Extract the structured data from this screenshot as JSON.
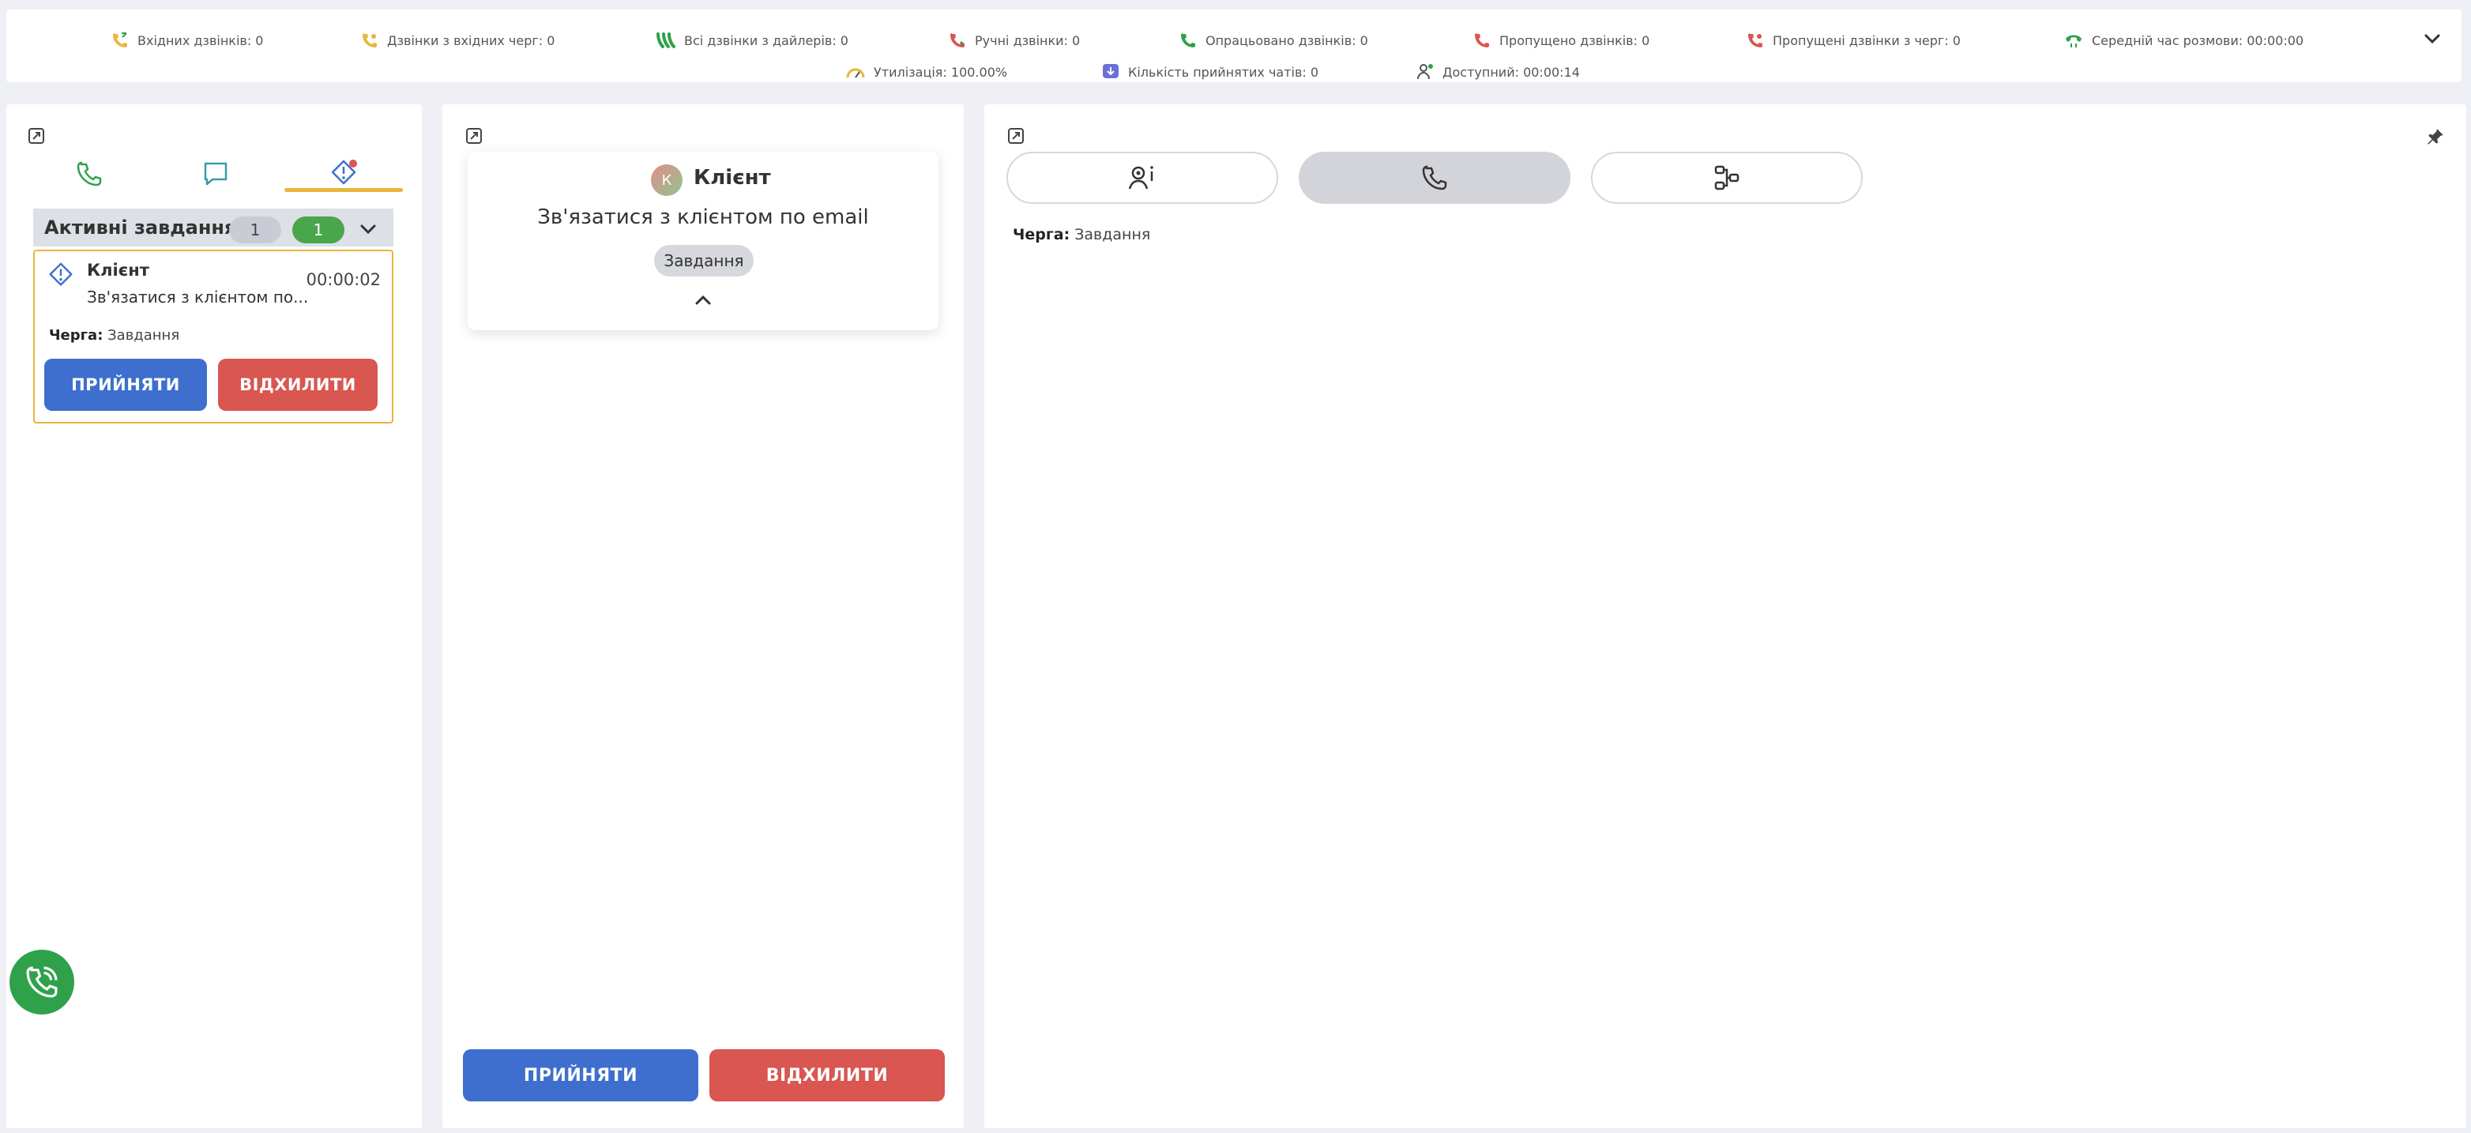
{
  "stats": {
    "incoming_calls": "Вхідних дзвінків: 0",
    "queue_calls": "Дзвінки з вхідних черг: 0",
    "dialer_calls": "Всі дзвінки з дайлерів: 0",
    "manual_calls": "Ручні дзвінки: 0",
    "processed_calls": "Опрацьовано дзвінків: 0",
    "missed_calls": "Пропущено дзвінків: 0",
    "missed_queue_calls": "Пропущені дзвінки з черг: 0",
    "avg_talk_time": "Середній час розмови: 00:00:00",
    "utilization": "Утилізація: 100.00%",
    "accepted_chats": "Кількість прийнятих чатів: 0",
    "available": "Доступний: 00:00:14"
  },
  "left_panel": {
    "tabs": [
      {
        "icon": "phone-icon"
      },
      {
        "icon": "chat-icon"
      },
      {
        "icon": "task-alert-icon",
        "active": true,
        "has_notification": true
      }
    ],
    "tasks_header": {
      "title": "Активні завдання",
      "count_total": "1",
      "count_active": "1"
    },
    "task_card": {
      "name": "Клієнт",
      "description": "Зв'язатися з клієнтом по...",
      "time": "00:00:02",
      "queue_label": "Черга:",
      "queue_value": "Завдання",
      "accept_label": "ПРИЙНЯТИ",
      "reject_label": "ВІДХИЛИТИ"
    }
  },
  "middle_panel": {
    "avatar_letter": "К",
    "client_name": "Клієнт",
    "description": "Зв'язатися з клієнтом по email",
    "tag": "Завдання",
    "accept_label": "ПРИЙНЯТИ",
    "reject_label": "ВІДХИЛИТИ"
  },
  "right_panel": {
    "tabs": [
      {
        "icon": "contact-info-icon"
      },
      {
        "icon": "phone-icon",
        "active": true
      },
      {
        "icon": "flow-icon"
      }
    ],
    "queue_label": "Черга:",
    "queue_value": "Завдання"
  },
  "colors": {
    "accent_blue": "#3e6fce",
    "accent_red": "#d95651",
    "accent_green": "#49a64a",
    "accent_yellow": "#e8b63c",
    "background": "#eef0f5"
  }
}
